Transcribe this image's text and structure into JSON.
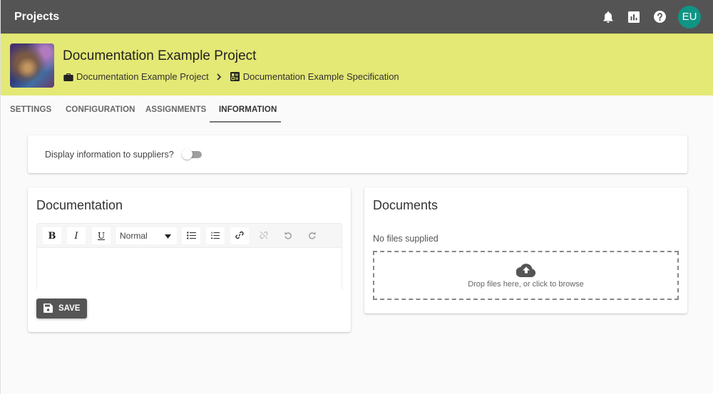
{
  "appbar": {
    "title": "Projects",
    "actions": [
      {
        "name": "notifications",
        "icon": "bell-icon"
      },
      {
        "name": "reports",
        "icon": "bar-chart-icon"
      },
      {
        "name": "help",
        "icon": "help-circle-icon"
      }
    ],
    "avatar_initials": "EU",
    "avatar_color": "#109484"
  },
  "project": {
    "title": "Documentation Example Project",
    "thumbnail_icon": "earth-image",
    "breadcrumb": [
      {
        "label": "Documentation Example Project",
        "icon": "briefcase-icon"
      },
      {
        "label": "Documentation Example Specification",
        "icon": "specification-icon"
      }
    ],
    "header_color": "#e4e875"
  },
  "tabs": [
    {
      "label": "SETTINGS",
      "active": false
    },
    {
      "label": "CONFIGURATION",
      "active": false
    },
    {
      "label": "ASSIGNMENTS",
      "active": false
    },
    {
      "label": "INFORMATION",
      "active": true
    }
  ],
  "info": {
    "toggle_label": "Display information to suppliers?",
    "toggle_on": false
  },
  "documentation": {
    "title": "Documentation",
    "toolbar": {
      "bold": "B",
      "italic": "I",
      "underline": "U",
      "format_selected": "Normal",
      "buttons": [
        "bullet-list-icon",
        "numbered-list-icon",
        "link-icon",
        "unlink-icon",
        "undo-icon",
        "redo-icon"
      ]
    },
    "content": "",
    "save_label": "SAVE"
  },
  "documents": {
    "title": "Documents",
    "empty_text": "No files supplied",
    "dropzone_text": "Drop files here, or click to browse"
  }
}
